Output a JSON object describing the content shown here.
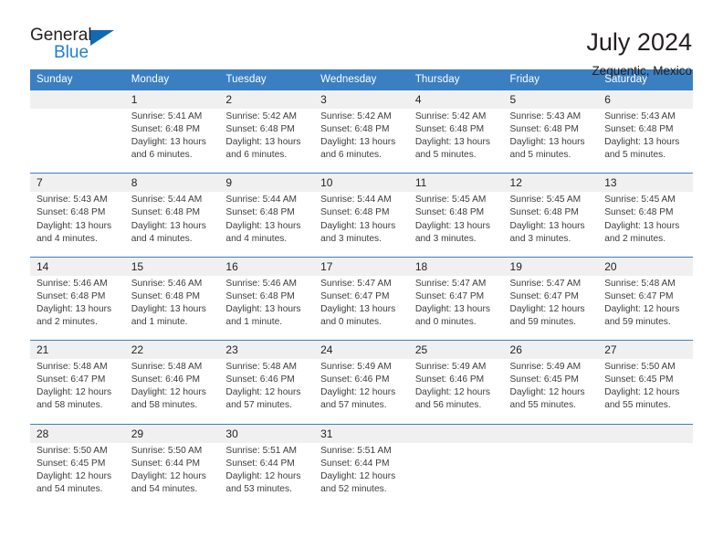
{
  "brand": {
    "name_dark": "General",
    "name_blue": "Blue",
    "accent_color": "#1f7fd0",
    "triangle_color": "#1268b3"
  },
  "header": {
    "title": "July 2024",
    "subtitle": "Zequentic, Mexico",
    "header_bg": "#3a7fc1",
    "daynum_bg": "#f0f0f0"
  },
  "weekdays": [
    "Sunday",
    "Monday",
    "Tuesday",
    "Wednesday",
    "Thursday",
    "Friday",
    "Saturday"
  ],
  "weeks": [
    [
      {
        "day": "",
        "sunrise": "",
        "sunset": "",
        "daylight1": "",
        "daylight2": ""
      },
      {
        "day": "1",
        "sunrise": "Sunrise: 5:41 AM",
        "sunset": "Sunset: 6:48 PM",
        "daylight1": "Daylight: 13 hours",
        "daylight2": "and 6 minutes."
      },
      {
        "day": "2",
        "sunrise": "Sunrise: 5:42 AM",
        "sunset": "Sunset: 6:48 PM",
        "daylight1": "Daylight: 13 hours",
        "daylight2": "and 6 minutes."
      },
      {
        "day": "3",
        "sunrise": "Sunrise: 5:42 AM",
        "sunset": "Sunset: 6:48 PM",
        "daylight1": "Daylight: 13 hours",
        "daylight2": "and 6 minutes."
      },
      {
        "day": "4",
        "sunrise": "Sunrise: 5:42 AM",
        "sunset": "Sunset: 6:48 PM",
        "daylight1": "Daylight: 13 hours",
        "daylight2": "and 5 minutes."
      },
      {
        "day": "5",
        "sunrise": "Sunrise: 5:43 AM",
        "sunset": "Sunset: 6:48 PM",
        "daylight1": "Daylight: 13 hours",
        "daylight2": "and 5 minutes."
      },
      {
        "day": "6",
        "sunrise": "Sunrise: 5:43 AM",
        "sunset": "Sunset: 6:48 PM",
        "daylight1": "Daylight: 13 hours",
        "daylight2": "and 5 minutes."
      }
    ],
    [
      {
        "day": "7",
        "sunrise": "Sunrise: 5:43 AM",
        "sunset": "Sunset: 6:48 PM",
        "daylight1": "Daylight: 13 hours",
        "daylight2": "and 4 minutes."
      },
      {
        "day": "8",
        "sunrise": "Sunrise: 5:44 AM",
        "sunset": "Sunset: 6:48 PM",
        "daylight1": "Daylight: 13 hours",
        "daylight2": "and 4 minutes."
      },
      {
        "day": "9",
        "sunrise": "Sunrise: 5:44 AM",
        "sunset": "Sunset: 6:48 PM",
        "daylight1": "Daylight: 13 hours",
        "daylight2": "and 4 minutes."
      },
      {
        "day": "10",
        "sunrise": "Sunrise: 5:44 AM",
        "sunset": "Sunset: 6:48 PM",
        "daylight1": "Daylight: 13 hours",
        "daylight2": "and 3 minutes."
      },
      {
        "day": "11",
        "sunrise": "Sunrise: 5:45 AM",
        "sunset": "Sunset: 6:48 PM",
        "daylight1": "Daylight: 13 hours",
        "daylight2": "and 3 minutes."
      },
      {
        "day": "12",
        "sunrise": "Sunrise: 5:45 AM",
        "sunset": "Sunset: 6:48 PM",
        "daylight1": "Daylight: 13 hours",
        "daylight2": "and 3 minutes."
      },
      {
        "day": "13",
        "sunrise": "Sunrise: 5:45 AM",
        "sunset": "Sunset: 6:48 PM",
        "daylight1": "Daylight: 13 hours",
        "daylight2": "and 2 minutes."
      }
    ],
    [
      {
        "day": "14",
        "sunrise": "Sunrise: 5:46 AM",
        "sunset": "Sunset: 6:48 PM",
        "daylight1": "Daylight: 13 hours",
        "daylight2": "and 2 minutes."
      },
      {
        "day": "15",
        "sunrise": "Sunrise: 5:46 AM",
        "sunset": "Sunset: 6:48 PM",
        "daylight1": "Daylight: 13 hours",
        "daylight2": "and 1 minute."
      },
      {
        "day": "16",
        "sunrise": "Sunrise: 5:46 AM",
        "sunset": "Sunset: 6:48 PM",
        "daylight1": "Daylight: 13 hours",
        "daylight2": "and 1 minute."
      },
      {
        "day": "17",
        "sunrise": "Sunrise: 5:47 AM",
        "sunset": "Sunset: 6:47 PM",
        "daylight1": "Daylight: 13 hours",
        "daylight2": "and 0 minutes."
      },
      {
        "day": "18",
        "sunrise": "Sunrise: 5:47 AM",
        "sunset": "Sunset: 6:47 PM",
        "daylight1": "Daylight: 13 hours",
        "daylight2": "and 0 minutes."
      },
      {
        "day": "19",
        "sunrise": "Sunrise: 5:47 AM",
        "sunset": "Sunset: 6:47 PM",
        "daylight1": "Daylight: 12 hours",
        "daylight2": "and 59 minutes."
      },
      {
        "day": "20",
        "sunrise": "Sunrise: 5:48 AM",
        "sunset": "Sunset: 6:47 PM",
        "daylight1": "Daylight: 12 hours",
        "daylight2": "and 59 minutes."
      }
    ],
    [
      {
        "day": "21",
        "sunrise": "Sunrise: 5:48 AM",
        "sunset": "Sunset: 6:47 PM",
        "daylight1": "Daylight: 12 hours",
        "daylight2": "and 58 minutes."
      },
      {
        "day": "22",
        "sunrise": "Sunrise: 5:48 AM",
        "sunset": "Sunset: 6:46 PM",
        "daylight1": "Daylight: 12 hours",
        "daylight2": "and 58 minutes."
      },
      {
        "day": "23",
        "sunrise": "Sunrise: 5:48 AM",
        "sunset": "Sunset: 6:46 PM",
        "daylight1": "Daylight: 12 hours",
        "daylight2": "and 57 minutes."
      },
      {
        "day": "24",
        "sunrise": "Sunrise: 5:49 AM",
        "sunset": "Sunset: 6:46 PM",
        "daylight1": "Daylight: 12 hours",
        "daylight2": "and 57 minutes."
      },
      {
        "day": "25",
        "sunrise": "Sunrise: 5:49 AM",
        "sunset": "Sunset: 6:46 PM",
        "daylight1": "Daylight: 12 hours",
        "daylight2": "and 56 minutes."
      },
      {
        "day": "26",
        "sunrise": "Sunrise: 5:49 AM",
        "sunset": "Sunset: 6:45 PM",
        "daylight1": "Daylight: 12 hours",
        "daylight2": "and 55 minutes."
      },
      {
        "day": "27",
        "sunrise": "Sunrise: 5:50 AM",
        "sunset": "Sunset: 6:45 PM",
        "daylight1": "Daylight: 12 hours",
        "daylight2": "and 55 minutes."
      }
    ],
    [
      {
        "day": "28",
        "sunrise": "Sunrise: 5:50 AM",
        "sunset": "Sunset: 6:45 PM",
        "daylight1": "Daylight: 12 hours",
        "daylight2": "and 54 minutes."
      },
      {
        "day": "29",
        "sunrise": "Sunrise: 5:50 AM",
        "sunset": "Sunset: 6:44 PM",
        "daylight1": "Daylight: 12 hours",
        "daylight2": "and 54 minutes."
      },
      {
        "day": "30",
        "sunrise": "Sunrise: 5:51 AM",
        "sunset": "Sunset: 6:44 PM",
        "daylight1": "Daylight: 12 hours",
        "daylight2": "and 53 minutes."
      },
      {
        "day": "31",
        "sunrise": "Sunrise: 5:51 AM",
        "sunset": "Sunset: 6:44 PM",
        "daylight1": "Daylight: 12 hours",
        "daylight2": "and 52 minutes."
      },
      {
        "day": "",
        "sunrise": "",
        "sunset": "",
        "daylight1": "",
        "daylight2": ""
      },
      {
        "day": "",
        "sunrise": "",
        "sunset": "",
        "daylight1": "",
        "daylight2": ""
      },
      {
        "day": "",
        "sunrise": "",
        "sunset": "",
        "daylight1": "",
        "daylight2": ""
      }
    ]
  ]
}
